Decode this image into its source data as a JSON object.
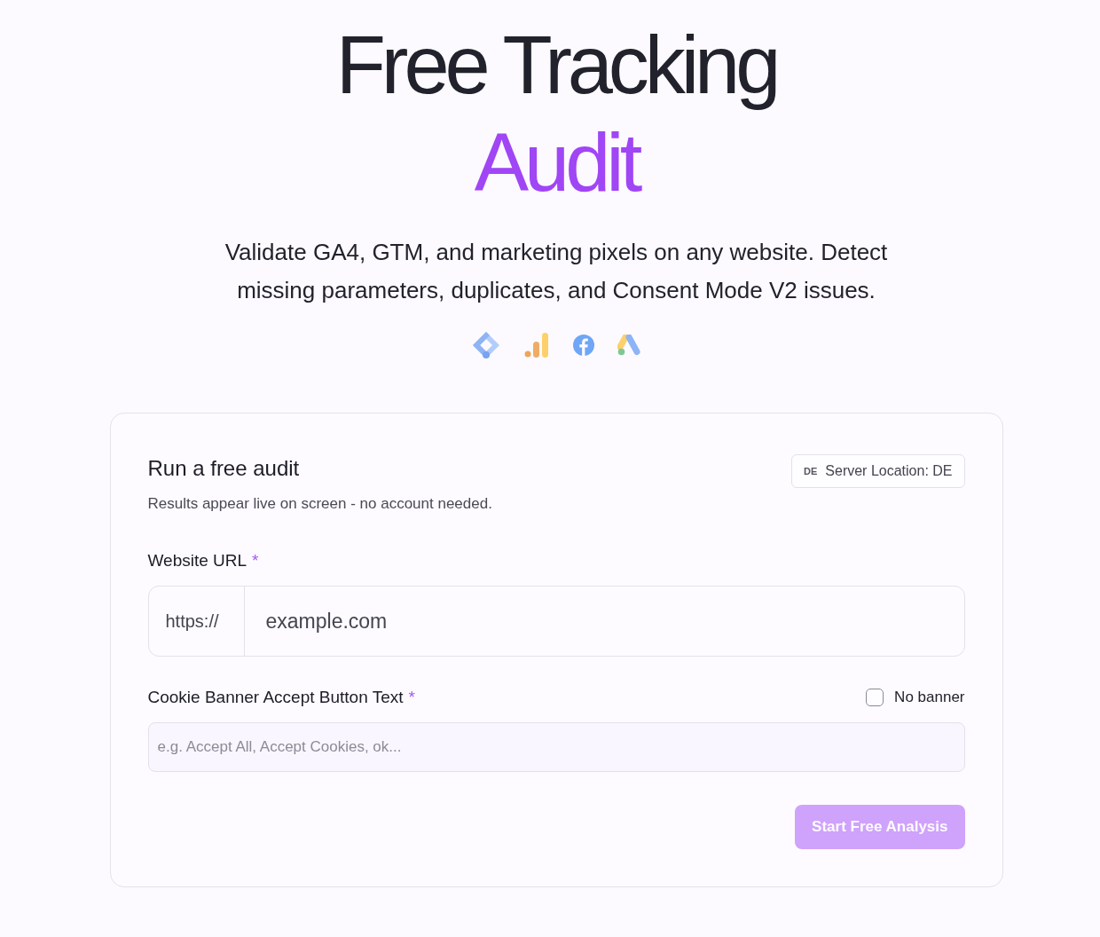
{
  "hero": {
    "title_line_1": "Free Tracking",
    "title_line_2": "Audit",
    "subtitle": "Validate GA4, GTM, and marketing pixels on any website. Detect missing parameters, duplicates, and Consent Mode V2 issues."
  },
  "card": {
    "title": "Run a free audit",
    "subtitle": "Results appear live on screen - no account needed.",
    "server_badge": {
      "code": "DE",
      "label": "Server Location: DE"
    },
    "url_field": {
      "label": "Website URL",
      "required_mark": "*",
      "prefix": "https://",
      "placeholder": "example.com"
    },
    "cookie_field": {
      "label": "Cookie Banner Accept Button Text",
      "required_mark": "*",
      "placeholder": "e.g. Accept All, Accept Cookies, ok...",
      "no_banner": {
        "label": "No banner",
        "checked": false
      }
    },
    "submit_button": {
      "label": "Start Free Analysis",
      "disabled": true
    }
  }
}
